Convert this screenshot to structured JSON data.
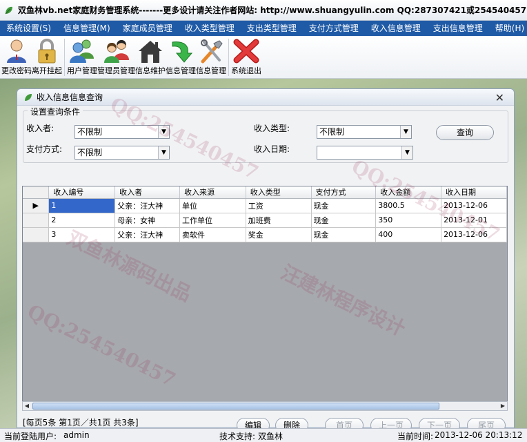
{
  "window": {
    "title": "双鱼林vb.net家庭财务管理系统-------更多设计请关注作者网站:   http://www.shuangyulin.com  QQ:287307421或254540457"
  },
  "menu": [
    {
      "label": "系统设置(S)"
    },
    {
      "label": "信息管理(M)"
    },
    {
      "label": "家庭成员管理"
    },
    {
      "label": "收入类型管理"
    },
    {
      "label": "支出类型管理"
    },
    {
      "label": "支付方式管理"
    },
    {
      "label": "收入信息管理"
    },
    {
      "label": "支出信息管理"
    },
    {
      "label": "帮助(H)"
    }
  ],
  "toolbar": [
    {
      "label": "更改密码",
      "icon": "user-key-icon"
    },
    {
      "label": "离开挂起",
      "icon": "padlock-icon"
    },
    {
      "label": "用户管理",
      "icon": "users-icon"
    },
    {
      "label": "管理员管理",
      "icon": "admins-icon"
    },
    {
      "label": "信息维护",
      "icon": "home-icon"
    },
    {
      "label": "信息管理",
      "icon": "green-arrow-icon"
    },
    {
      "label": "信息管理",
      "icon": "tools-icon"
    },
    {
      "label": "系统退出",
      "icon": "red-x-icon"
    }
  ],
  "child_window": {
    "title": "收入信息信息查询",
    "close_label": "✕"
  },
  "query": {
    "group_label": "设置查询条件",
    "receiver_label": "收入者:",
    "receiver_value": "不限制",
    "income_type_label": "收入类型:",
    "income_type_value": "不限制",
    "payment_label": "支付方式:",
    "payment_value": "不限制",
    "date_label": "收入日期:",
    "date_value": "",
    "query_button": "查询"
  },
  "table": {
    "columns": [
      "收入编号",
      "收入者",
      "收入来源",
      "收入类型",
      "支付方式",
      "收入金额",
      "收入日期"
    ],
    "rows": [
      [
        "1",
        "父亲：汪大神",
        "单位",
        "工资",
        "现金",
        "3800.5",
        "2013-12-06"
      ],
      [
        "2",
        "母亲：女神",
        "工作单位",
        "加班费",
        "现金",
        "350",
        "2013-12-01"
      ],
      [
        "3",
        "父亲：汪大神",
        "卖软件",
        "奖金",
        "现金",
        "400",
        "2013-12-06"
      ]
    ],
    "current_row_marker": "▶"
  },
  "paging": {
    "summary": "[每页5条  第1页／共1页     共3条]",
    "edit_button": "编辑",
    "delete_button": "删除",
    "first_button": "首页",
    "prev_button": "上一页",
    "next_button": "下一页",
    "last_button": "尾页"
  },
  "status": {
    "user_label": "当前登陆用户:",
    "user_value": "admin",
    "support_label": "技术支持:",
    "support_value": "双鱼林",
    "time_label": "当前时间:",
    "time_value": "2013-12-06 20:13:12"
  },
  "watermark": {
    "qq": "QQ:254540457",
    "brand1": "双鱼林源码出品",
    "brand2": "汪建林程序设计"
  },
  "colors": {
    "menubar": "#1f5aa6",
    "selection": "#3367c9"
  }
}
